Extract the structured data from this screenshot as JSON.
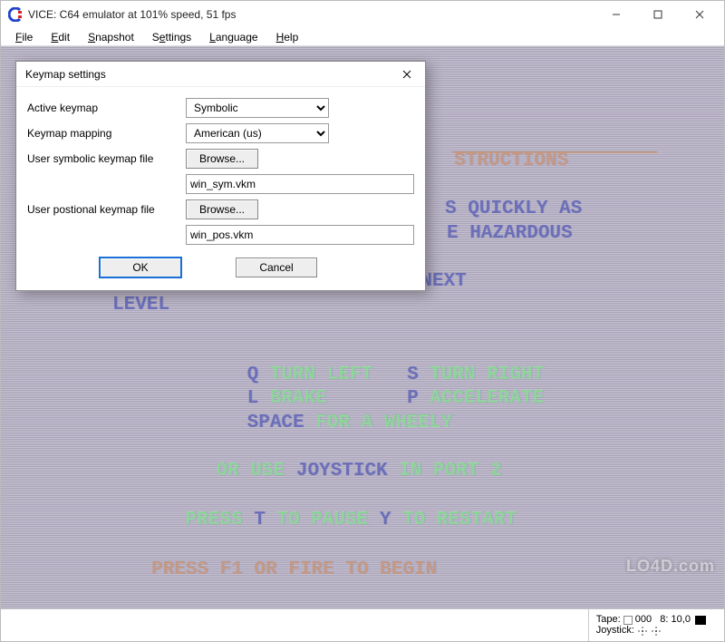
{
  "window": {
    "title": "VICE: C64 emulator at 101% speed, 51 fps"
  },
  "menu": {
    "file": "File",
    "edit": "Edit",
    "snapshot": "Snapshot",
    "settings": "Settings",
    "language": "Language",
    "help": "Help"
  },
  "dialog": {
    "title": "Keymap settings",
    "labels": {
      "active_keymap": "Active keymap",
      "keymap_mapping": "Keymap mapping",
      "user_symbolic_file": "User symbolic keymap file",
      "user_positional_file": "User postional keymap file"
    },
    "values": {
      "active_keymap": "Symbolic",
      "keymap_mapping": "American (us)",
      "symbolic_file": "win_sym.vkm",
      "positional_file": "win_pos.vkm"
    },
    "buttons": {
      "browse": "Browse...",
      "ok": "OK",
      "cancel": "Cancel"
    }
  },
  "emulator_text": {
    "l1_a": "STRUCTIONS",
    "l2_a": "S QUICKLY AS",
    "l2_b": "E HAZARDOUS",
    "l3": "RIDE OVER FLAGS TO MOVE TO NEXT",
    "l3b": "LEVEL",
    "l4_q": "Q",
    "l4_tl": " TURN LEFT",
    "l4_s": "S",
    "l4_tr": " TURN RIGHT",
    "l5_l": "L",
    "l5_bk": " BRAKE",
    "l5_p": "P",
    "l5_ac": " ACCELERATE",
    "l6_sp": "SPACE",
    "l6_w": " FOR A WHEELY",
    "l7_a": "OR USE ",
    "l7_b": "JOYSTICK",
    "l7_c": " IN PORT 2",
    "l8_a": "PRESS ",
    "l8_t": "T",
    "l8_b": " TO PAUSE ",
    "l8_y": "Y",
    "l8_c": " TO RESTART",
    "l9": "PRESS F1 OR FIRE TO BEGIN"
  },
  "status": {
    "tape_label": "Tape:",
    "tape_value": "000",
    "drive_value": "8: 10,0",
    "joystick_label": "Joystick:"
  },
  "watermark": "LO4D.com"
}
